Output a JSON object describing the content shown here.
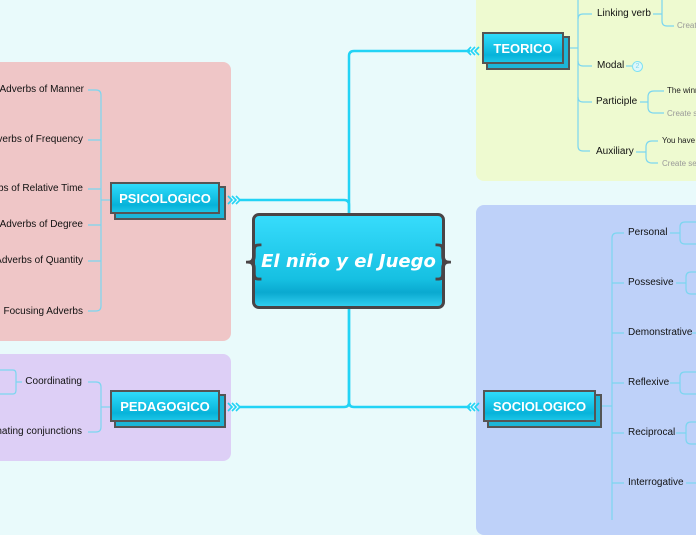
{
  "central": {
    "title": "El niño y el Juego"
  },
  "branches": {
    "teorico": {
      "label": "TEORICO",
      "children": [
        {
          "label": "Linking verb",
          "sub": [
            "",
            "Create"
          ]
        },
        {
          "label": "Modal",
          "badge": "2"
        },
        {
          "label": "Participle",
          "sub": [
            "The winn",
            "Create se"
          ]
        },
        {
          "label": "Auxiliary",
          "sub": [
            "You have",
            "Create se"
          ]
        }
      ]
    },
    "psicologico": {
      "label": "PSICOLOGICO",
      "children": [
        "Adverbs of Manner",
        "Adverbs of Frequency",
        "Adverbs of Relative Time",
        "Adverbs of Degree",
        "Adverbs of Quantity",
        "Focusing Adverbs"
      ]
    },
    "pedagogico": {
      "label": "PEDAGOGICO",
      "children": [
        "Coordinating",
        "Subordinating conjunctions"
      ]
    },
    "sociologico": {
      "label": "SOCIOLOGICO",
      "children": [
        "Personal",
        "Possesive",
        "Demonstrative",
        "Reflexive",
        "Reciprocal",
        "Interrogative"
      ]
    }
  },
  "colors": {
    "background": "#e9fafb",
    "connector": "#22d3f5",
    "topic": "#0fbfe2",
    "psicologico_region": "#efc6c7",
    "pedagogico_region": "#ddcff6",
    "teorico_region": "#eefad0",
    "sociologico_region": "#bed1f9"
  }
}
